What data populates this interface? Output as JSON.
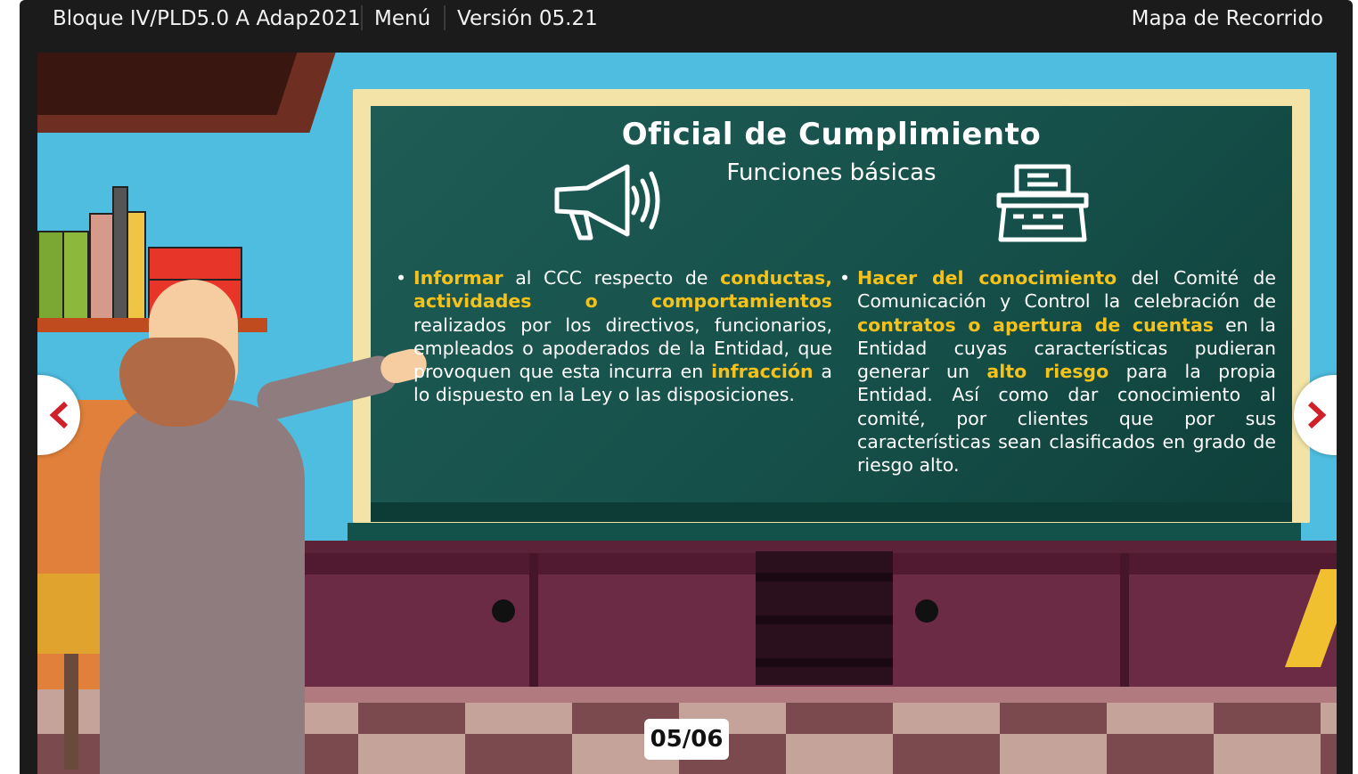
{
  "topbar": {
    "course_title": "Bloque IV/PLD5.0 A Adap2021",
    "menu_label": "Menú",
    "version_label": "Versión 05.21",
    "map_label": "Mapa de Recorrido"
  },
  "slide": {
    "title": "Oficial de Cumplimiento",
    "subtitle": "Funciones básicas",
    "left_icon": "megaphone-icon",
    "right_icon": "typewriter-icon",
    "left_text": {
      "bullet": "•",
      "p1": "Informar",
      "p2": " al CCC respecto de ",
      "p3": "conductas, actividades o comportamientos",
      "p4": " realizados por los directivos, funcionarios, empleados o apoderados de la Entidad, que provoquen que esta incurra en ",
      "p5": "infracción",
      "p6": " a lo dispuesto en la Ley o las disposiciones."
    },
    "right_text": {
      "bullet": "•",
      "p1": "Hacer del conocimiento",
      "p2": " del Comité de Comunicación y Control la celebración de ",
      "p3": "contratos o apertura de cuentas",
      "p4": " en la Entidad cuyas características pudieran generar un ",
      "p5": "alto riesgo",
      "p6": " para la propia Entidad. Así como dar conocimiento al comité, por clientes que por sus características sean clasificados en grado de riesgo alto."
    },
    "counter": "05/06"
  },
  "nav": {
    "prev_icon": "chevron-left-icon",
    "next_icon": "chevron-right-icon",
    "arrow_color": "#d0202a"
  },
  "colors": {
    "highlight": "#f4c21b",
    "board": "#1e5c55",
    "topbar": "#1b1b1b"
  }
}
